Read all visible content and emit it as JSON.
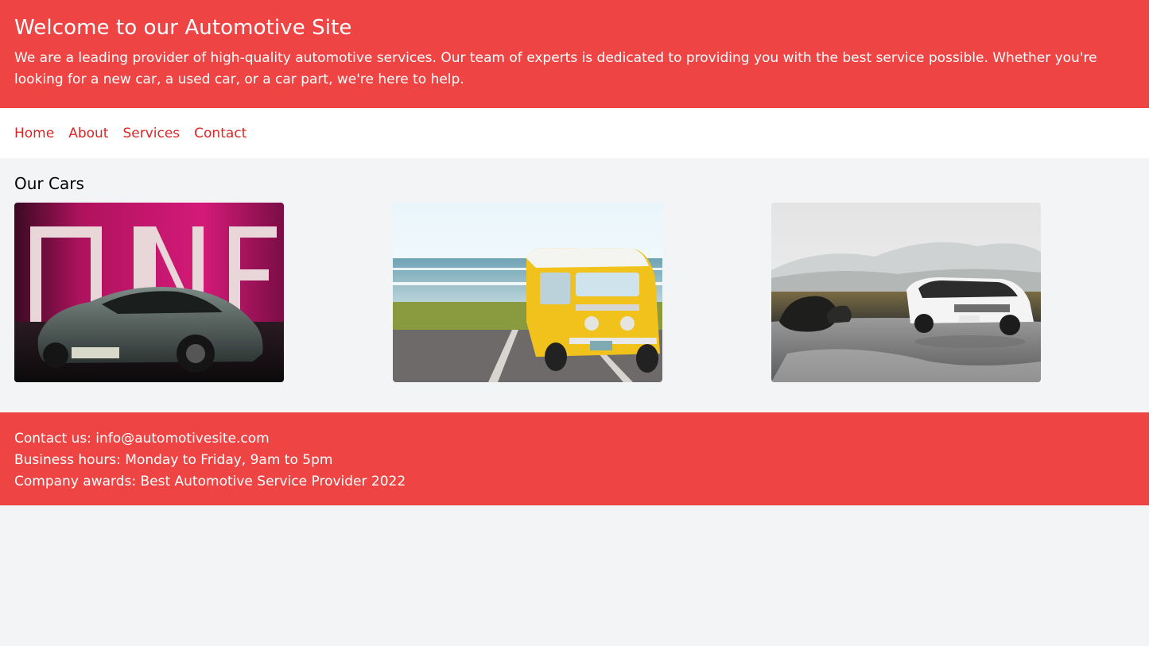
{
  "header": {
    "title": "Welcome to our Automotive Site",
    "intro": "We are a leading provider of high-quality automotive services. Our team of experts is dedicated to providing you with the best service possible. Whether you're looking for a new car, a used car, or a car part, we're here to help."
  },
  "nav": {
    "items": [
      {
        "label": "Home"
      },
      {
        "label": "About"
      },
      {
        "label": "Services"
      },
      {
        "label": "Contact"
      }
    ]
  },
  "main": {
    "heading": "Our Cars"
  },
  "footer": {
    "contact": "Contact us: info@automotivesite.com",
    "hours": "Business hours: Monday to Friday, 9am to 5pm",
    "awards": "Company awards: Best Automotive Service Provider 2022"
  },
  "colors": {
    "brand_red": "#ef4444",
    "link_red": "#dc2626",
    "page_bg": "#f3f4f6"
  }
}
